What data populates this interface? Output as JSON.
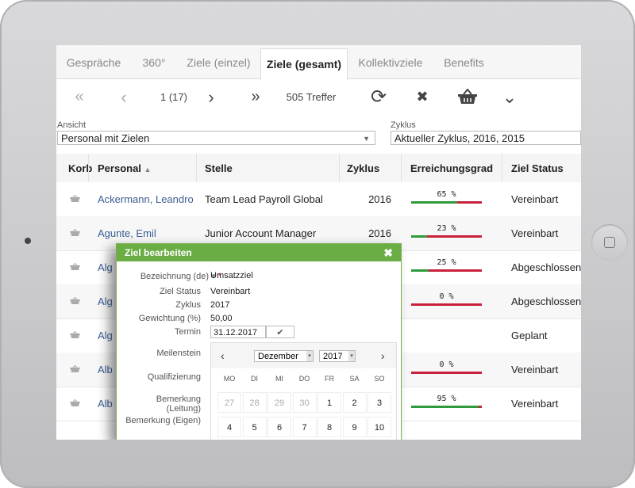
{
  "tabs": [
    {
      "label": "Gespräche"
    },
    {
      "label": "360°"
    },
    {
      "label": "Ziele (einzel)"
    },
    {
      "label": "Ziele (gesamt)"
    },
    {
      "label": "Kollektivziele"
    },
    {
      "label": "Benefits"
    }
  ],
  "toolbar": {
    "first_icon": "«",
    "prev_icon": "‹",
    "page": "1 (17)",
    "next_icon": "›",
    "last_icon": "»",
    "hits": "505 Treffer",
    "refresh_icon": "⟳",
    "clear_icon": "✖",
    "expand_icon": "⌄"
  },
  "filters": {
    "ansicht_label": "Ansicht",
    "ansicht_value": "Personal mit Zielen",
    "zyklus_label": "Zyklus",
    "zyklus_value": "Aktueller Zyklus, 2016, 2015",
    "caret": "▼"
  },
  "table": {
    "headers": {
      "korb": "Korb",
      "personal": "Personal",
      "sort_icon": "▲",
      "stelle": "Stelle",
      "zyklus": "Zyklus",
      "erreichungsgrad": "Erreichungsgrad",
      "status": "Ziel Status"
    },
    "rows": [
      {
        "personal": "Ackermann, Leandro",
        "stelle": "Team Lead Payroll Global",
        "zyklus": "2016",
        "pct_label": "65 %",
        "pct": 65,
        "status": "Vereinbart"
      },
      {
        "personal": "Agunte, Emil",
        "stelle": "Junior Account Manager",
        "zyklus": "2016",
        "pct_label": "23 %",
        "pct": 23,
        "status": "Vereinbart"
      },
      {
        "personal": "Alg",
        "stelle": "",
        "zyklus": "",
        "pct_label": "25 %",
        "pct": 25,
        "status": "Abgeschlossen"
      },
      {
        "personal": "Alg",
        "stelle": "",
        "zyklus": "",
        "pct_label": "0 %",
        "pct": 0,
        "status": "Abgeschlossen"
      },
      {
        "personal": "Alg",
        "stelle": "",
        "zyklus": "",
        "pct_label": "",
        "pct": null,
        "status": "Geplant"
      },
      {
        "personal": "Alb",
        "stelle": "",
        "zyklus": "",
        "pct_label": "0 %",
        "pct": 0,
        "status": "Vereinbart"
      },
      {
        "personal": "Alb",
        "stelle": "",
        "zyklus": "",
        "pct_label": "95 %",
        "pct": 95,
        "status": "Vereinbart"
      }
    ]
  },
  "dialog": {
    "title": "Ziel bearbeiten",
    "close_icon": "✖",
    "bezeichnung_label": "Bezeichnung (de)",
    "bezeichnung_marker": "▾",
    "required_mark": "*",
    "bezeichnung_value": "Umsatzziel",
    "status_label": "Ziel Status",
    "status_value": "Vereinbart",
    "zyklus_label": "Zyklus",
    "zyklus_value": "2017",
    "gewichtung_label": "Gewichtung (%)",
    "gewichtung_value": "50,00",
    "termin_label": "Termin",
    "termin_value": "31.12.2017",
    "confirm_icon": "✔",
    "meilenstein_label": "Meilenstein",
    "qualifizierung_label": "Qualifizierung",
    "bem_leitung_label": "Bemerkung (Leitung)",
    "bem_eigen_label": "Bemerkung (Eigen)"
  },
  "calendar": {
    "prev_icon": "‹",
    "next_icon": "›",
    "month": "Dezember",
    "year": "2017",
    "caret": "▾",
    "weekdays": [
      "MO",
      "DI",
      "MI",
      "DO",
      "FR",
      "SA",
      "SO"
    ],
    "week1": [
      "27",
      "28",
      "29",
      "30",
      "1",
      "2",
      "3"
    ],
    "week2": [
      "4",
      "5",
      "6",
      "7",
      "8",
      "9",
      "10"
    ]
  }
}
